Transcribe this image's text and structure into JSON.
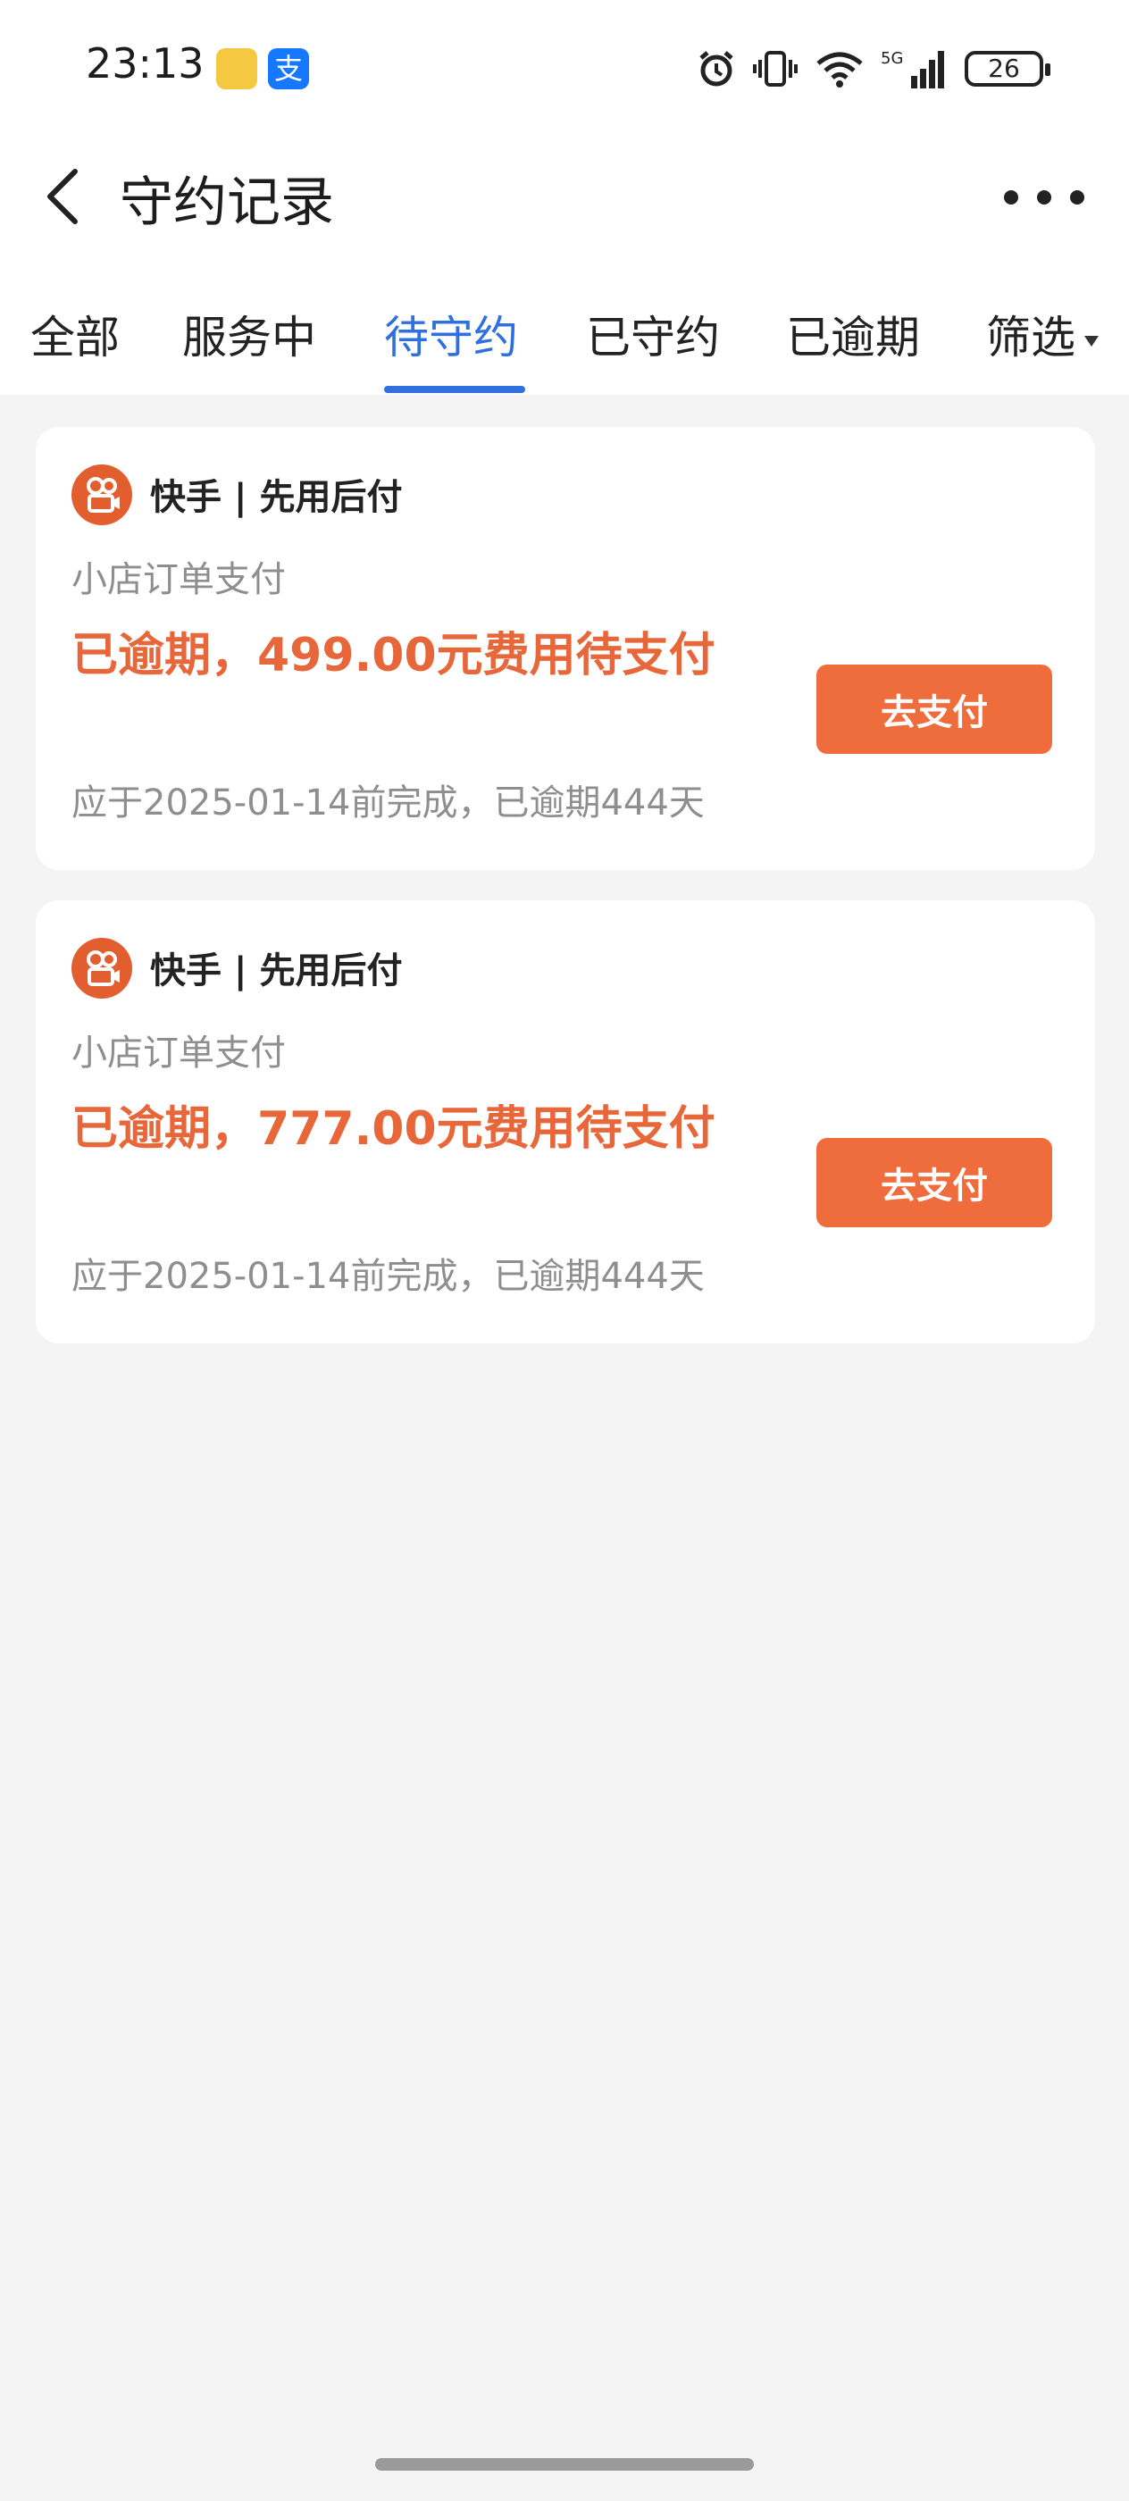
{
  "status_bar": {
    "time": "23:13",
    "alipay_glyph": "支",
    "network": "5G",
    "battery": "26"
  },
  "header": {
    "title": "守约记录"
  },
  "tabs": [
    {
      "label": "全部"
    },
    {
      "label": "服务中"
    },
    {
      "label": "待守约"
    },
    {
      "label": "已守约"
    },
    {
      "label": "已逾期"
    },
    {
      "label": "筛选"
    }
  ],
  "active_tab": "待守约",
  "records": [
    {
      "brand": "快手 | 先用后付",
      "subtitle": "小店订单支付",
      "headline": "已逾期，499.00元费用待支付",
      "due": "应于2025-01-14前完成，已逾期444天",
      "button": "去支付"
    },
    {
      "brand": "快手 | 先用后付",
      "subtitle": "小店订单支付",
      "headline": "已逾期，777.00元费用待支付",
      "due": "应于2025-01-14前完成，已逾期444天",
      "button": "去支付"
    }
  ],
  "colors": {
    "accent_blue": "#2f6fe0",
    "overdue_orange": "#e8673a",
    "pay_button": "#ef6c3c",
    "kuaishou_logo": "#e25e2e",
    "page_bg": "#f4f4f4"
  },
  "icons": {
    "back": "chevron-left-icon",
    "more": "more-horizontal-icon",
    "alarm": "alarm-icon",
    "vibrate": "vibrate-icon",
    "wifi": "wifi-icon",
    "signal": "signal-icon",
    "battery": "battery-icon",
    "filter_caret": "caret-down-icon",
    "brand": "kuaishou-logo-icon"
  }
}
